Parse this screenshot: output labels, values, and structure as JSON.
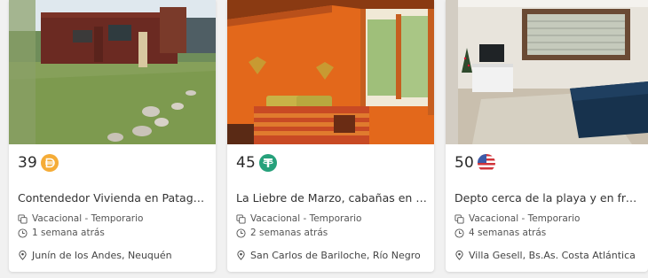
{
  "listings": [
    {
      "price": "39",
      "currency_icon": "dai-coin-icon",
      "currency_color": "#f5ac37",
      "title": "Contendedor Vivienda en Patagonia",
      "type": "Vacacional - Temporario",
      "posted": "1 semana atrás",
      "location": "Junín de los Andes, Neuquén"
    },
    {
      "price": "45",
      "currency_icon": "tether-coin-icon",
      "currency_color": "#26a17b",
      "title": "La Liebre de Marzo, cabañas en el b...",
      "type": "Vacacional - Temporario",
      "posted": "2 semanas atrás",
      "location": "San Carlos de Bariloche, Río Negro"
    },
    {
      "price": "50",
      "currency_icon": "usd-flag-icon",
      "currency_color": "#3c5ba9",
      "title": "Depto cerca de la playa y en frente ...",
      "type": "Vacacional - Temporario",
      "posted": "4 semanas atrás",
      "location": "Villa Gesell, Bs.As. Costa Atlántica"
    }
  ]
}
